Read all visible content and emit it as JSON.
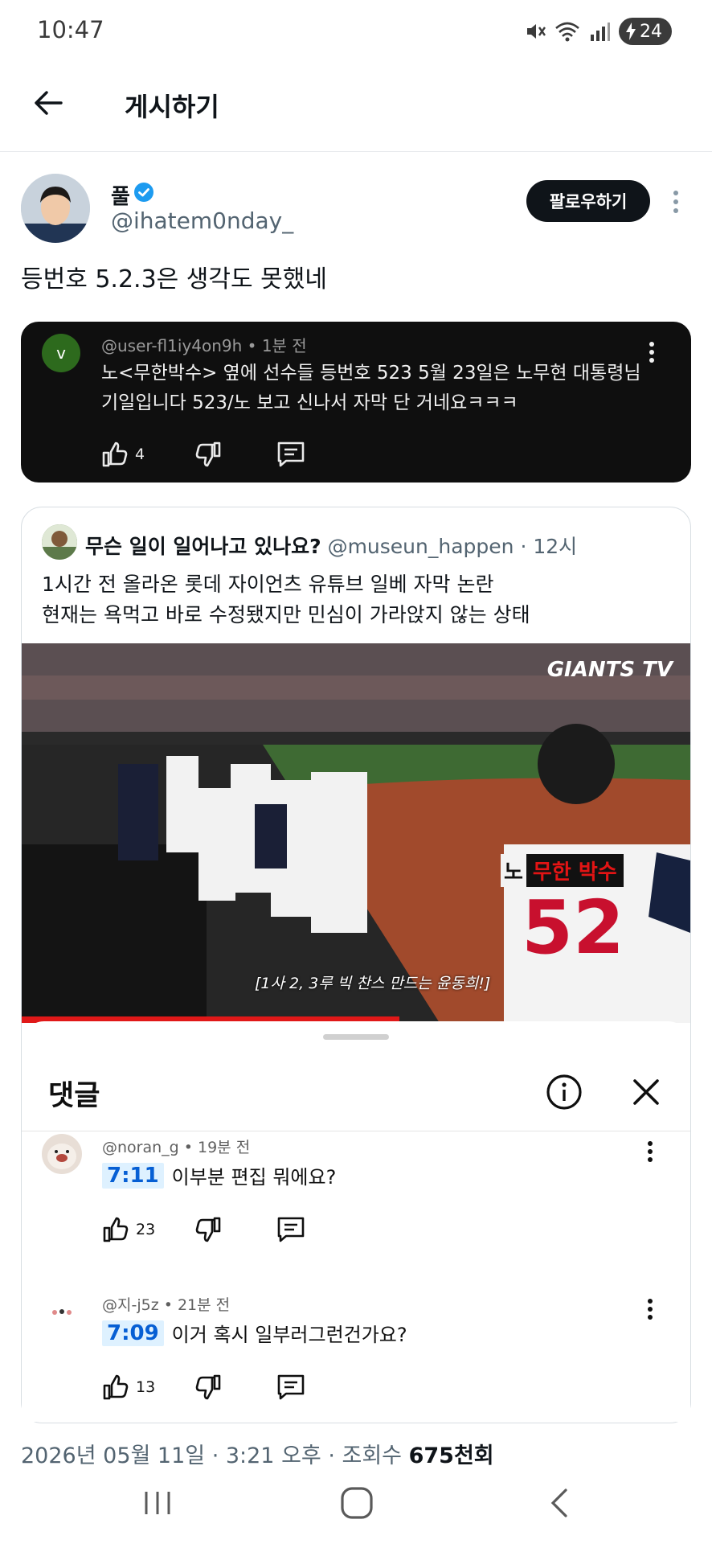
{
  "status_bar": {
    "time": "10:47",
    "battery": "24"
  },
  "header": {
    "title": "게시하기"
  },
  "author": {
    "name": "풀",
    "handle": "@ihatem0nday_",
    "follow_label": "팔로우하기"
  },
  "post": {
    "text": "등번호 5.2.3은 생각도 못했네"
  },
  "yt_comment": {
    "avatar_letter": "v",
    "meta": "@user-fl1iy4on9h • 1분 전",
    "text": "노<무한박수>  옆에 선수들 등번호 523 5월 23일은 노무현 대통령님 기일입니다 523/노 보고 신나서 자막 단 거네요ㅋㅋㅋ",
    "likes": "4"
  },
  "quote": {
    "name": "무슨 일이 일어나고 있나요?",
    "handle": "@museun_happen",
    "time": "· 12시",
    "line1": "1시간 전 올라온 롯데 자이언츠 유튜브 일베 자막 논란",
    "line2": "현재는 욕먹고 바로 수정됐지만 민심이 가라앉지 않는 상태",
    "video": {
      "watermark": "GIANTS TV",
      "caption_no": "노",
      "caption_red": "무한 박수",
      "jersey_number": "52",
      "subtitle": "[1사 2, 3루 빅 찬스 만드는 윤동희!]"
    },
    "comments_sheet": {
      "title": "댓글",
      "comments": [
        {
          "meta": "@noran_g • 19분 전",
          "timestamp": "7:11",
          "text": "이부분 편집 뭐에요?",
          "likes": "23"
        },
        {
          "meta": "@지-j5z • 21분 전",
          "timestamp": "7:09",
          "text": "이거 혹시 일부러그런건가요?",
          "likes": "13"
        }
      ]
    }
  },
  "footer": {
    "date": "2026년 05월 11일 · 3:21 오후 · 조회수 ",
    "views": "675천회"
  },
  "colors": {
    "accent_blue": "#1d9bf0",
    "timestamp_bg": "#def1ff",
    "timestamp_text": "#065fd4"
  },
  "icons": [
    "arrow-left-icon",
    "verified-badge-icon",
    "more-vertical-icon",
    "thumbs-up-icon",
    "thumbs-down-icon",
    "reply-icon",
    "info-icon",
    "close-icon",
    "recent-apps-icon",
    "home-icon",
    "back-nav-icon"
  ]
}
